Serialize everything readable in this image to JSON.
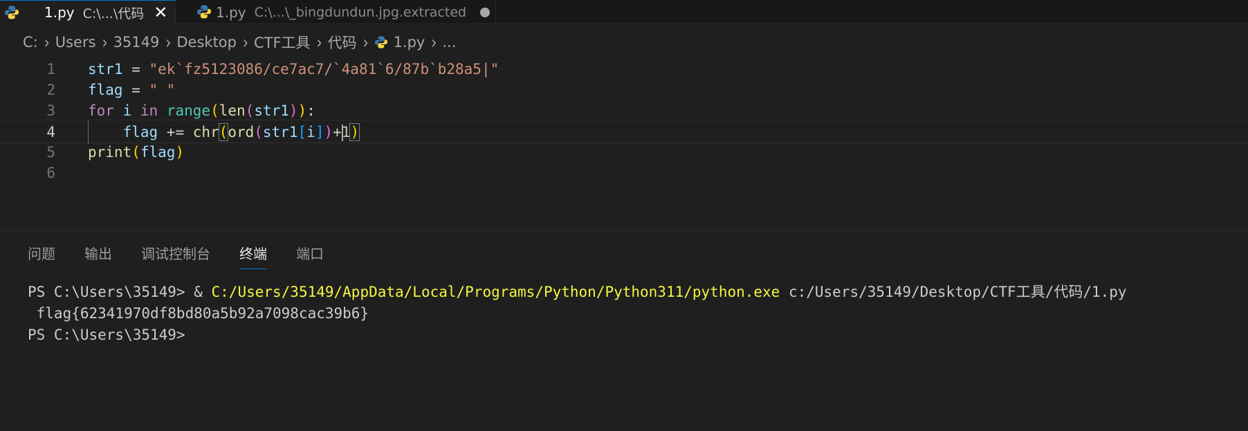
{
  "tabs": [
    {
      "name": "1.py",
      "desc": "C:\\...\\代码",
      "close": "✕"
    },
    {
      "name": "1.py",
      "desc": "C:\\...\\_bingdundun.jpg.extracted"
    }
  ],
  "breadcrumb": {
    "items": [
      "C:",
      "Users",
      "35149",
      "Desktop",
      "CTF工具",
      "代码",
      "1.py",
      "..."
    ]
  },
  "editor": {
    "line_numbers": [
      "1",
      "2",
      "3",
      "4",
      "5",
      "6"
    ],
    "active_line": "4",
    "l1": {
      "var": "str1",
      "eq": " = ",
      "str_a": "\"ek`fz5123086/ce7ac7/`4a81`6/87b`b28a5",
      "str_b": "|\""
    },
    "l2": {
      "var": "flag",
      "eq": " = ",
      "str": "\" \""
    },
    "l3": {
      "kw_for": "for",
      "var_i": "i",
      "kw_in": "in",
      "fn_range": "range",
      "p_open1": "(",
      "fn_len": "len",
      "p_open2": "(",
      "arg": "str1",
      "p_close2": ")",
      "p_close1": ")",
      "colon": ":"
    },
    "l4": {
      "indent": "    ",
      "var": "flag",
      "op": " += ",
      "fn_chr": "chr",
      "p_open1": "(",
      "fn_ord": "ord",
      "p_open2": "(",
      "arg": "str1",
      "br_open": "[",
      "idx": "i",
      "br_close": "]",
      "p_close2": ")",
      "plus": "+",
      "num": "1",
      "p_close1": ")"
    },
    "l5": {
      "fn_print": "print",
      "p_open": "(",
      "arg": "flag",
      "p_close": ")"
    }
  },
  "panel": {
    "tabs": [
      "问题",
      "输出",
      "调试控制台",
      "终端",
      "端口"
    ],
    "active_tab": "终端"
  },
  "terminal": {
    "prompt1": "PS C:\\Users\\35149> ",
    "amp": "& ",
    "exe": "C:/Users/35149/AppData/Local/Programs/Python/Python311/python.exe",
    "script": " c:/Users/35149/Desktop/CTF工具/代码/1.py",
    "output": " flag{62341970df8bd80a5b92a7098cac39b6}",
    "prompt2": "PS C:\\Users\\35149>"
  },
  "colors": {
    "background": "#1f1f1f",
    "accent": "#0078d4",
    "terminal_exe": "#f5f543"
  },
  "icons": [
    "python-file-icon",
    "close-icon",
    "unsaved-dot-icon",
    "chevron-right-icon"
  ]
}
